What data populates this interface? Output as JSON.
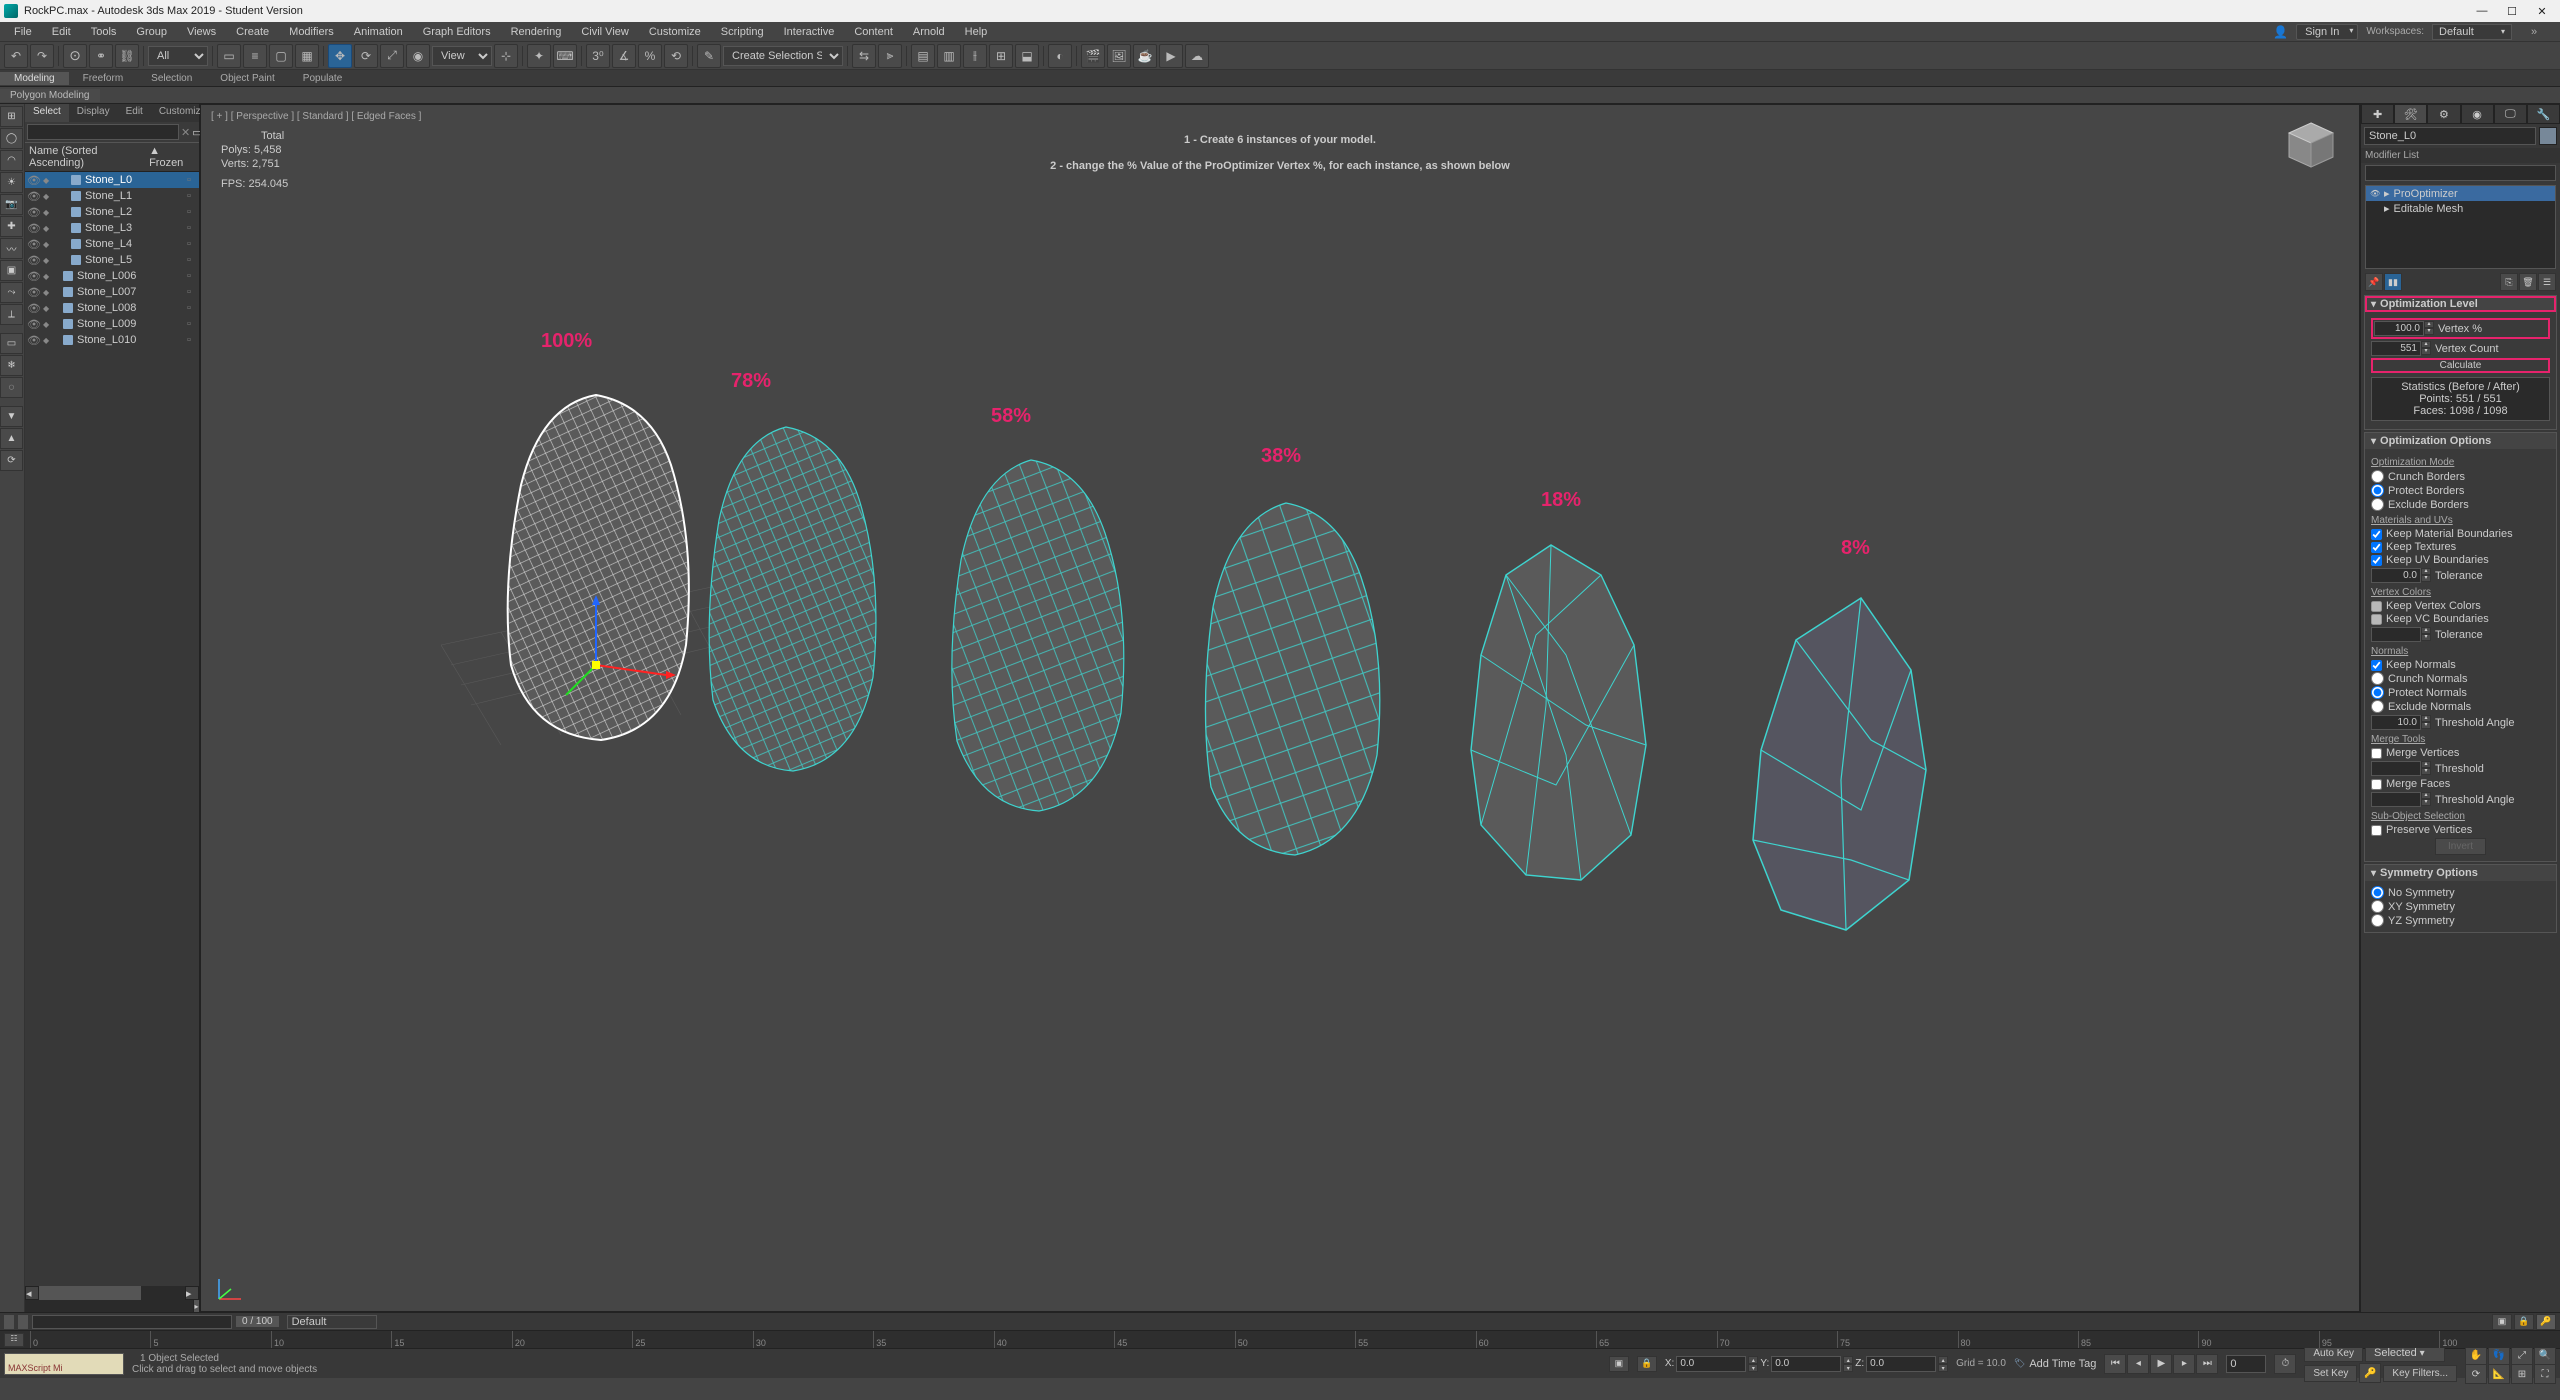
{
  "window": {
    "title": "RockPC.max - Autodesk 3ds Max 2019 - Student Version",
    "min": "—",
    "max": "☐",
    "close": "✕"
  },
  "menubar": {
    "items": [
      "File",
      "Edit",
      "Tools",
      "Group",
      "Views",
      "Create",
      "Modifiers",
      "Animation",
      "Graph Editors",
      "Rendering",
      "Civil View",
      "Customize",
      "Scripting",
      "Interactive",
      "Content",
      "Arnold",
      "Help"
    ],
    "signin": "Sign In",
    "workspace_label": "Workspaces:",
    "workspace_value": "Default"
  },
  "toolbar": {
    "sel_filter": "All",
    "view_drop": "View",
    "create_drop": "Create Selection Se"
  },
  "ribbon": {
    "tabs": [
      "Modeling",
      "Freeform",
      "Selection",
      "Object Paint",
      "Populate"
    ],
    "panels": [
      "Polygon Modeling"
    ]
  },
  "scene": {
    "tabs": [
      "Select",
      "Display",
      "Edit",
      "Customize"
    ],
    "header_name": "Name (Sorted Ascending)",
    "header_frozen": "▲ Frozen",
    "items": [
      {
        "name": "Stone_L0",
        "sel": true,
        "pad": 1
      },
      {
        "name": "Stone_L1",
        "sel": false,
        "pad": 1
      },
      {
        "name": "Stone_L2",
        "sel": false,
        "pad": 1
      },
      {
        "name": "Stone_L3",
        "sel": false,
        "pad": 1
      },
      {
        "name": "Stone_L4",
        "sel": false,
        "pad": 1
      },
      {
        "name": "Stone_L5",
        "sel": false,
        "pad": 1
      },
      {
        "name": "Stone_L006",
        "sel": false,
        "pad": 0
      },
      {
        "name": "Stone_L007",
        "sel": false,
        "pad": 0
      },
      {
        "name": "Stone_L008",
        "sel": false,
        "pad": 0
      },
      {
        "name": "Stone_L009",
        "sel": false,
        "pad": 0
      },
      {
        "name": "Stone_L010",
        "sel": false,
        "pad": 0
      }
    ]
  },
  "viewport": {
    "label": "[ + ] [ Perspective ] [ Standard ] [ Edged Faces ]",
    "stats_total": "Total",
    "polys": "Polys:      5,458",
    "verts": "Verts:      2,751",
    "fps": "FPS:       254.045",
    "overlay1": "1 - Create 6 instances of your model.",
    "overlay2": "2 - change the % Value of the ProOptimizer Vertex %, for each instance, as shown below",
    "labels": [
      "100%",
      "78%",
      "58%",
      "38%",
      "18%",
      "8%"
    ]
  },
  "cmd": {
    "objname": "Stone_L0",
    "modlabel": "Modifier List",
    "stack": [
      {
        "name": "ProOptimizer",
        "sel": true,
        "exp": "▸"
      },
      {
        "name": "Editable Mesh",
        "sel": false,
        "exp": "▸"
      }
    ],
    "roll_optlevel": "Optimization Level",
    "vertex_pct_label": "Vertex %",
    "vertex_pct_value": "100.0",
    "vertex_count_label": "Vertex Count",
    "vertex_count_value": "551",
    "calculate": "Calculate",
    "stats_h": "Statistics (Before / After)",
    "stats_points": "Points: 551 / 551",
    "stats_faces": "Faces: 1098 / 1098",
    "roll_optopt": "Optimization Options",
    "optmode": "Optimization Mode",
    "crunch_borders": "Crunch Borders",
    "protect_borders": "Protect Borders",
    "exclude_borders": "Exclude Borders",
    "mat_uvs": "Materials and UVs",
    "keep_mat": "Keep Material Boundaries",
    "keep_tex": "Keep Textures",
    "keep_uv": "Keep UV Boundaries",
    "tolerance": "Tolerance",
    "tolerance_val": "0.0",
    "vcolors": "Vertex Colors",
    "keep_vc": "Keep Vertex Colors",
    "keep_vcb": "Keep VC Boundaries",
    "normals": "Normals",
    "keep_normals": "Keep Normals",
    "crunch_normals": "Crunch Normals",
    "protect_normals": "Protect Normals",
    "exclude_normals": "Exclude Normals",
    "thr_angle": "Threshold Angle",
    "thr_angle_val": "10.0",
    "merge_tools": "Merge Tools",
    "merge_vertices": "Merge Vertices",
    "threshold": "Threshold",
    "merge_faces": "Merge Faces",
    "subobj_sel": "Sub-Object Selection",
    "preserve_verts": "Preserve Vertices",
    "invert": "Invert",
    "roll_sym": "Symmetry Options",
    "no_sym": "No Symmetry",
    "xy_sym": "XY Symmetry",
    "yz_sym": "YZ Symmetry"
  },
  "trackbar": {
    "frame": "0 / 100",
    "default": "Default"
  },
  "timeline": {
    "ticks": [
      "0",
      "5",
      "10",
      "15",
      "20",
      "25",
      "30",
      "35",
      "40",
      "45",
      "50",
      "55",
      "60",
      "65",
      "70",
      "75",
      "80",
      "85",
      "90",
      "95",
      "100"
    ]
  },
  "status": {
    "maxscript": "MAXScript Mi",
    "selcount": "1 Object Selected",
    "hint": "Click and drag to select and move objects",
    "xl": "X:",
    "yl": "Y:",
    "zl": "Z:",
    "x": "0.0",
    "y": "0.0",
    "z": "0.0",
    "grid": "Grid = 10.0",
    "timetag": "Add Time Tag",
    "autokey": "Auto Key",
    "setkey": "Set Key",
    "selected": "Selected",
    "keyfilters": "Key Filters..."
  }
}
